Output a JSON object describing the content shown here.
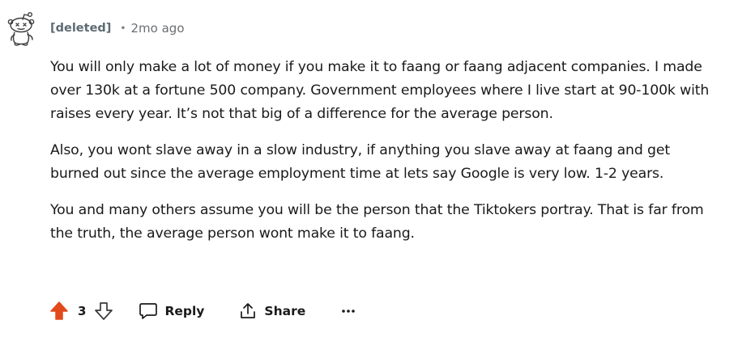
{
  "comment": {
    "author": "[deleted]",
    "separator": "•",
    "time": "2mo ago",
    "paragraphs": [
      "You will only make a lot of money if you make it to faang or faang adjacent companies. I made over 130k at a fortune 500 company. Government employees where I live start at 90-100k with raises every year. It’s not that big of a difference for the average person.",
      "Also, you wont slave away in a slow industry, if anything you slave away at faang and get burned out since the average employment time at lets say Google is very low. 1-2 years.",
      "You and many others assume you will be the person that the Tiktokers portray. That is far from the truth, the average person wont make it to faang."
    ]
  },
  "actions": {
    "score": "3",
    "reply_label": "Reply",
    "share_label": "Share",
    "upvoted": true
  },
  "icons": {
    "avatar": "deleted-user-avatar-icon",
    "upvote": "upvote-arrow-icon",
    "downvote": "downvote-arrow-icon",
    "reply": "comment-bubble-icon",
    "share": "share-icon",
    "more": "more-options-icon"
  },
  "colors": {
    "upvote_active": "#e24a1c",
    "author": "#5c6b73",
    "meta": "#6b6f72",
    "text": "#1a1a1b"
  }
}
